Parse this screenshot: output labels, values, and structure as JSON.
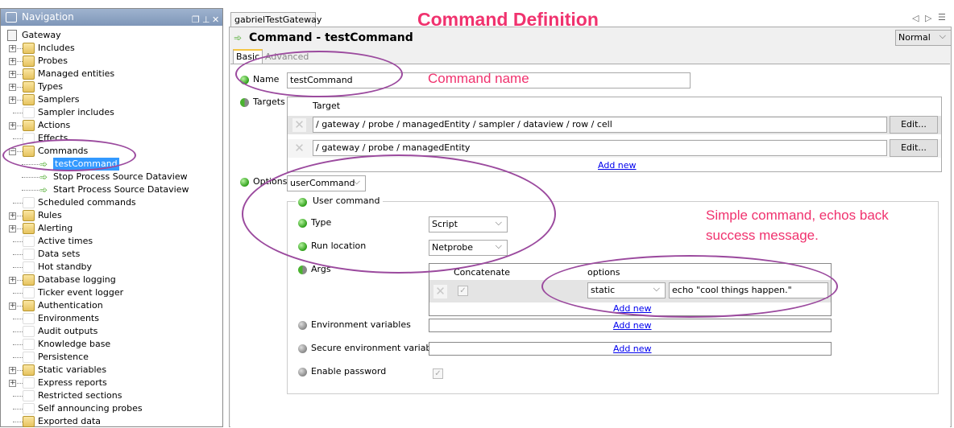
{
  "navigation": {
    "title": "Navigation",
    "root": "Gateway",
    "items": [
      {
        "label": "Includes",
        "icon": "folder",
        "expander": "+"
      },
      {
        "label": "Probes",
        "icon": "folder",
        "expander": "+"
      },
      {
        "label": "Managed entities",
        "icon": "folder",
        "expander": "+"
      },
      {
        "label": "Types",
        "icon": "folder",
        "expander": "+"
      },
      {
        "label": "Samplers",
        "icon": "folder",
        "expander": "+"
      },
      {
        "label": "Sampler includes",
        "icon": "blank",
        "expander": ""
      },
      {
        "label": "Actions",
        "icon": "folder",
        "expander": "+"
      },
      {
        "label": "Effects",
        "icon": "blank",
        "expander": ""
      },
      {
        "label": "Commands",
        "icon": "folder",
        "expander": "-"
      },
      {
        "label": "testCommand",
        "icon": "command",
        "child": true,
        "selected": true
      },
      {
        "label": "Stop Process Source Dataview",
        "icon": "command",
        "child": true
      },
      {
        "label": "Start Process Source Dataview",
        "icon": "command",
        "child": true
      },
      {
        "label": "Scheduled commands",
        "icon": "blank",
        "expander": ""
      },
      {
        "label": "Rules",
        "icon": "folder",
        "expander": "+"
      },
      {
        "label": "Alerting",
        "icon": "folder",
        "expander": "+"
      },
      {
        "label": "Active times",
        "icon": "blank",
        "expander": ""
      },
      {
        "label": "Data sets",
        "icon": "blank",
        "expander": ""
      },
      {
        "label": "Hot standby",
        "icon": "blank",
        "expander": ""
      },
      {
        "label": "Database logging",
        "icon": "folder",
        "expander": "+"
      },
      {
        "label": "Ticker event logger",
        "icon": "blank",
        "expander": ""
      },
      {
        "label": "Authentication",
        "icon": "folder",
        "expander": "+"
      },
      {
        "label": "Environments",
        "icon": "blank",
        "expander": ""
      },
      {
        "label": "Audit outputs",
        "icon": "blank",
        "expander": ""
      },
      {
        "label": "Knowledge base",
        "icon": "blank",
        "expander": ""
      },
      {
        "label": "Persistence",
        "icon": "blank",
        "expander": ""
      },
      {
        "label": "Static variables",
        "icon": "folder",
        "expander": "+"
      },
      {
        "label": "Express reports",
        "icon": "blank",
        "expander": "+"
      },
      {
        "label": "Restricted sections",
        "icon": "blank",
        "expander": ""
      },
      {
        "label": "Self announcing probes",
        "icon": "blank",
        "expander": ""
      },
      {
        "label": "Exported data",
        "icon": "folder",
        "expander": ""
      }
    ]
  },
  "editor": {
    "tab": "gabrielTestGateway",
    "title": "Command - testCommand",
    "mode": "Normal",
    "tabs": [
      "Basic",
      "Advanced"
    ],
    "name_label": "Name",
    "name_value": "testCommand",
    "targets_label": "Targets",
    "target_header": "Target",
    "targets": [
      "/ gateway / probe / managedEntity / sampler / dataview / row / cell",
      "/ gateway / probe / managedEntity"
    ],
    "edit_label": "Edit...",
    "add_new": "Add new",
    "options_label": "Options",
    "options_value": "userCommand",
    "user_command": {
      "legend": "User command",
      "type_label": "Type",
      "type_value": "Script",
      "run_label": "Run location",
      "run_value": "Netprobe",
      "args_label": "Args",
      "args_col1": "Concatenate",
      "args_col2": "options",
      "arg_type": "static",
      "arg_value": "echo \"cool things happen.\"",
      "env_label": "Environment variables",
      "secure_env_label": "Secure environment variables",
      "enable_password_label": "Enable password"
    }
  },
  "annotations": {
    "title": "Command Definition",
    "name_note": "Command name",
    "simple_note_1": "Simple command, echos back",
    "simple_note_2": "success message."
  }
}
